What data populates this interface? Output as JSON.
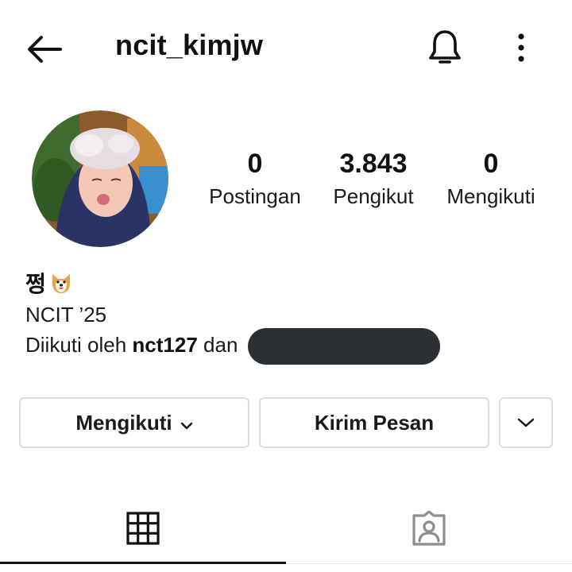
{
  "header": {
    "username": "ncit_kimjw",
    "back_icon": "arrow-left-icon",
    "notify_icon": "bell-icon",
    "more_icon": "more-vertical-icon"
  },
  "profile": {
    "avatar_icon": "profile-photo",
    "stats": [
      {
        "value": "0",
        "label": "Postingan"
      },
      {
        "value": "3.843",
        "label": "Pengikut"
      },
      {
        "value": "0",
        "label": "Mengikuti"
      }
    ],
    "display_name": "쩡",
    "display_emoji": "dog-face-emoji",
    "bio": "NCIT ’25",
    "followed_by_prefix": "Diikuti oleh",
    "followed_by_account": "nct127",
    "followed_by_suffix": "dan"
  },
  "actions": {
    "following_label": "Mengikuti",
    "message_label": "Kirim Pesan",
    "suggest_icon": "chevron-down-icon"
  },
  "tabs": {
    "grid_icon": "grid-icon",
    "tagged_icon": "tagged-person-icon"
  },
  "colors": {
    "text": "#111111",
    "border": "#dcdcdc",
    "redaction": "#2b2f33",
    "tab_inactive": "#8e8e8e"
  }
}
